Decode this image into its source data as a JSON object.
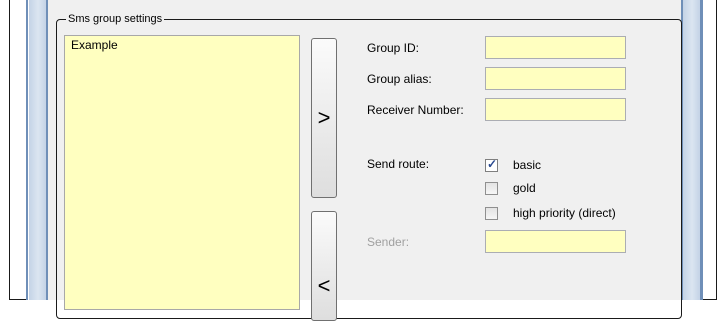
{
  "groupbox": {
    "title": "Sms group settings"
  },
  "group_list": {
    "items": [
      "Example"
    ]
  },
  "buttons": {
    "add_label": ">",
    "remove_label": "<"
  },
  "form": {
    "group_id_label": "Group ID:",
    "group_id_value": "",
    "group_alias_label": "Group alias:",
    "group_alias_value": "",
    "receiver_number_label": "Receiver Number:",
    "receiver_number_value": "",
    "send_route_label": "Send route:",
    "routes": [
      {
        "label": "basic",
        "checked": true
      },
      {
        "label": "gold",
        "checked": false
      },
      {
        "label": "high priority (direct)",
        "checked": false
      }
    ],
    "sender_label": "Sender:",
    "sender_value": ""
  },
  "colors": {
    "field_bg": "#ffffc0",
    "panel_bg": "#f0f0f0",
    "frame_blue": "#6f8fb8"
  }
}
